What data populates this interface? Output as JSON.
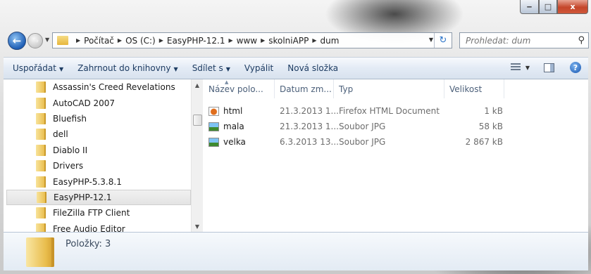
{
  "window": {
    "controls": {
      "minimize": "‒",
      "maximize": "□",
      "close": "x"
    }
  },
  "nav": {
    "back_icon": "back-arrow-icon",
    "forward_icon": "forward-arrow-icon"
  },
  "address": {
    "crumbs": [
      "Počítač",
      "OS (C:)",
      "EasyPHP-12.1",
      "www",
      "skolniAPP",
      "dum"
    ]
  },
  "search": {
    "placeholder": "Prohledat: dum"
  },
  "toolbar": {
    "organize": "Uspořádat",
    "include_in_library": "Zahrnout do knihovny",
    "share_with": "Sdílet s",
    "burn": "Vypálit",
    "new_folder": "Nová složka"
  },
  "tree": {
    "items": [
      "Assassin's Creed Revelations",
      "AutoCAD 2007",
      "Bluefish",
      "dell",
      "Diablo II",
      "Drivers",
      "EasyPHP-5.3.8.1",
      "EasyPHP-12.1",
      "FileZilla FTP Client",
      "Free Audio Editor"
    ],
    "selected": "EasyPHP-12.1"
  },
  "files": {
    "columns": [
      "Název polo...",
      "Datum zm...",
      "Typ",
      "Velikost"
    ],
    "rows": [
      {
        "name": "html",
        "date": "21.3.2013 1...",
        "type": "Firefox HTML Document",
        "size": "1 kB",
        "icon": "firefox-html-icon"
      },
      {
        "name": "mala",
        "date": "21.3.2013 1...",
        "type": "Soubor JPG",
        "size": "58 kB",
        "icon": "jpg-image-icon"
      },
      {
        "name": "velka",
        "date": "6.3.2013 13...",
        "type": "Soubor JPG",
        "size": "2 867 kB",
        "icon": "jpg-image-icon"
      }
    ]
  },
  "details": {
    "items_label": "Položky: 3"
  }
}
